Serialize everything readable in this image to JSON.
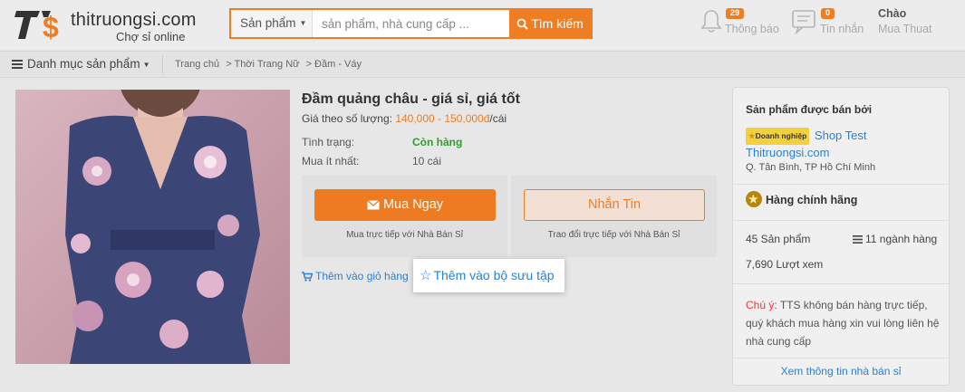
{
  "header": {
    "logo_name": "thitruongsi.com",
    "logo_tagline": "Chợ sỉ online",
    "search_category": "Sản phẩm",
    "search_placeholder": "sản phẩm, nhà cung cấp ...",
    "search_button": "Tìm kiếm",
    "notifications_count": "29",
    "notifications_label": "Thông báo",
    "messages_count": "0",
    "messages_label": "Tin nhắn",
    "greeting": "Chào",
    "user_name": "Mua Thuat"
  },
  "nav": {
    "category_menu": "Danh mục sản phẩm",
    "breadcrumb": [
      "Trang chủ",
      "> Thời Trang Nữ",
      "> Đầm - Váy"
    ]
  },
  "product": {
    "title": "Đầm quảng châu - giá sỉ, giá tốt",
    "price_label": "Giá theo số lượng:",
    "price_value": "140,000 - 150,000đ",
    "price_unit": "/cái",
    "status_label": "Tình trạng:",
    "status_value": "Còn hàng",
    "min_order_label": "Mua ít nhất:",
    "min_order_value": "10 cái",
    "buy_button": "Mua Ngay",
    "buy_caption": "Mua trực tiếp với Nhà Bán Sỉ",
    "chat_button": "Nhắn Tin",
    "chat_caption": "Trao đổi trực tiếp với Nhà Bán Sỉ",
    "add_to_cart": "Thêm vào giỏ hàng",
    "add_to_collection": "Thêm vào bộ sưu tập"
  },
  "seller": {
    "heading": "Sản phẩm được bán bởi",
    "badge": "Doanh nghiệp",
    "shop_name": "Shop Test",
    "shop_domain": "Thitruongsi.com",
    "location": "Q. Tân Bình, TP Hồ Chí Minh",
    "genuine": "Hàng chính hãng",
    "products_count": "45 Sản phẩm",
    "categories_count": "11 ngành hàng",
    "views": "7,690 Lượt xem",
    "note_label": "Chú ý:",
    "note_text": "TTS không bán hàng trực tiếp, quý khách mua hàng xin vui lòng liên hệ nhà cung cấp",
    "view_seller_link": "Xem thông tin nhà bán sỉ"
  },
  "colors": {
    "accent": "#ef7d22",
    "link": "#2d7fd3",
    "in_stock": "#2e9e2e",
    "warning": "#e53935"
  }
}
